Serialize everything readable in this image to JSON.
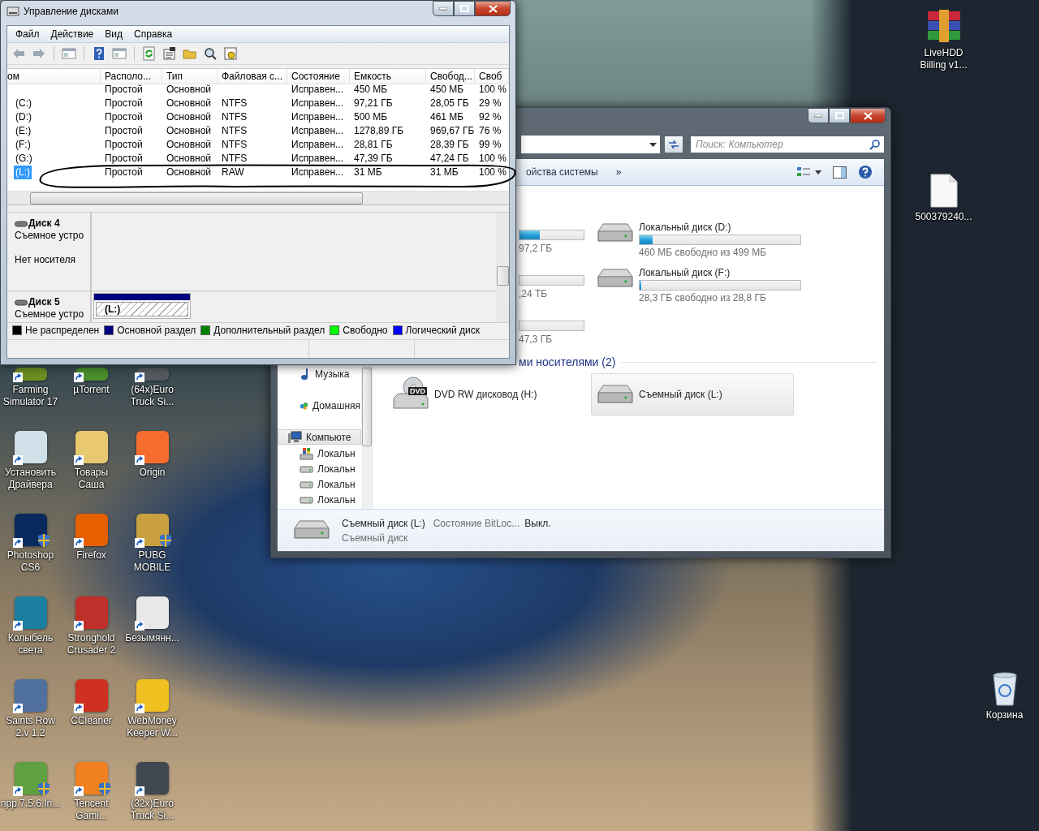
{
  "disk_management": {
    "title": "Управление дисками",
    "menu": [
      "Файл",
      "Действие",
      "Вид",
      "Справка"
    ],
    "columns": [
      "ом",
      "Располо...",
      "Тип",
      "Файловая с...",
      "Состояние",
      "Емкость",
      "Свобод...",
      "Своб"
    ],
    "rows": [
      {
        "layout": "Простой",
        "type": "Основной",
        "status": "Исправен...",
        "capacity": "450 МБ",
        "free": "450 МБ",
        "free_pct": "100 %",
        "selected": false
      },
      {
        "volume": "(C:)",
        "layout": "Простой",
        "type": "Основной",
        "fs": "NTFS",
        "status": "Исправен...",
        "capacity": "97,21 ГБ",
        "free": "28,05 ГБ",
        "free_pct": "29 %",
        "selected": false
      },
      {
        "volume": "(D:)",
        "layout": "Простой",
        "type": "Основной",
        "fs": "NTFS",
        "status": "Исправен...",
        "capacity": "500 МБ",
        "free": "461 МБ",
        "free_pct": "92 %",
        "selected": false
      },
      {
        "volume": "(E:)",
        "layout": "Простой",
        "type": "Основной",
        "fs": "NTFS",
        "status": "Исправен...",
        "capacity": "1278,89 ГБ",
        "free": "969,67 ГБ",
        "free_pct": "76 %",
        "selected": false
      },
      {
        "volume": "(F:)",
        "layout": "Простой",
        "type": "Основной",
        "fs": "NTFS",
        "status": "Исправен...",
        "capacity": "28,81 ГБ",
        "free": "28,39 ГБ",
        "free_pct": "99 %",
        "selected": false
      },
      {
        "volume": "(G:)",
        "layout": "Простой",
        "type": "Основной",
        "fs": "NTFS",
        "status": "Исправен...",
        "capacity": "47,39 ГБ",
        "free": "47,24 ГБ",
        "free_pct": "100 %",
        "selected": false
      },
      {
        "volume": "(L:)",
        "layout": "Простой",
        "type": "Основной",
        "fs": "RAW",
        "status": "Исправен...",
        "capacity": "31 МБ",
        "free": "31 МБ",
        "free_pct": "100 %",
        "selected": true
      }
    ],
    "disks": [
      {
        "name": "Диск 4",
        "type": "Съемное устро",
        "status": "Нет носителя"
      },
      {
        "name": "Диск 5",
        "type": "Съемное устро",
        "partition": "(L:)"
      }
    ],
    "legend": [
      {
        "label": "Не распределен",
        "color": "#000000"
      },
      {
        "label": "Основной раздел",
        "color": "#000080"
      },
      {
        "label": "Дополнительный раздел",
        "color": "#008000"
      },
      {
        "label": "Свободно",
        "color": "#00ff00"
      },
      {
        "label": "Логический диск",
        "color": "#0000ff"
      }
    ]
  },
  "explorer": {
    "search": {
      "placeholder": "Поиск: Компьютер"
    },
    "toolbar_item": "ойства системы",
    "more": "»",
    "nav": [
      {
        "label": "Музыка",
        "kind": "music",
        "selected": false
      },
      {
        "label": "Домашняя",
        "kind": "homegroup",
        "selected": false
      },
      {
        "label": "Компьюте",
        "kind": "computer",
        "selected": true
      },
      {
        "label": "Локальн",
        "kind": "system-drive",
        "selected": false
      },
      {
        "label": "Локальн",
        "kind": "drive",
        "selected": false
      },
      {
        "label": "Локальн",
        "kind": "drive",
        "selected": false
      },
      {
        "label": "Локальн",
        "kind": "drive",
        "selected": false
      }
    ],
    "drives": [
      {
        "info": "97,2 ГБ",
        "level": 0.32
      },
      {
        "name": "Локальный диск (D:)",
        "info": "460 МБ свободно из 499 МБ",
        "level": 0.08
      },
      {
        "info": ",24 ТБ"
      },
      {
        "name": "Локальный диск (F:)",
        "info": "28,3 ГБ свободно из 28,8 ГБ",
        "level": 0.01
      },
      {
        "info": "47,3 ГБ"
      }
    ],
    "section_title": "ми носителями (2)",
    "removable": [
      {
        "name": "DVD RW дисковод (H:)",
        "kind": "dvd",
        "icon_label": "DVD",
        "selected": false
      },
      {
        "name": "Съемный диск (L:)",
        "kind": "removable",
        "selected": true
      }
    ],
    "details": {
      "name": "Съемный диск (L:)",
      "property": "Состояние BitLoc...",
      "value": "Выкл.",
      "type": "Съемный диск"
    }
  },
  "desktop_icons": [
    {
      "lines": [
        "Farming",
        "Simulator 17"
      ],
      "color": "#6b8e23",
      "shield": false
    },
    {
      "lines": [
        "µTorrent"
      ],
      "color": "#4a8f2c",
      "shield": false
    },
    {
      "lines": [
        "(64x)Euro",
        "Truck Si..."
      ],
      "color": "#555a60",
      "shield": false
    },
    {
      "lines": [
        "Установить",
        "Драйвера"
      ],
      "color": "#cfe0e8",
      "shield": false
    },
    {
      "lines": [
        "Товары",
        "Саша"
      ],
      "color": "#e8c870",
      "shield": false
    },
    {
      "lines": [
        "Origin"
      ],
      "color": "#f56c2d",
      "shield": false
    },
    {
      "lines": [
        "Photoshop",
        "CS6"
      ],
      "color": "#0a2a5e",
      "shield": true
    },
    {
      "lines": [
        "Firefox"
      ],
      "color": "#e66000",
      "shield": false
    },
    {
      "lines": [
        "PUBG",
        "MOBILE"
      ],
      "color": "#c9a040",
      "shield": true
    },
    {
      "lines": [
        "Колыбель",
        "света"
      ],
      "color": "#1a7fa0",
      "shield": false
    },
    {
      "lines": [
        "Stronghold",
        "Crusader 2"
      ],
      "color": "#c0302a",
      "shield": false
    },
    {
      "lines": [
        "Безымянн..."
      ],
      "color": "#e8e8e8",
      "shield": false
    },
    {
      "lines": [
        "Saints Row",
        "2.v 1.2"
      ],
      "color": "#5070a0",
      "shield": false
    },
    {
      "lines": [
        "CCleaner"
      ],
      "color": "#d03020",
      "shield": false
    },
    {
      "lines": [
        "WebMoney",
        "Keeper W..."
      ],
      "color": "#f0c020",
      "shield": false
    },
    {
      "lines": [
        "npp.7.5.6.In..."
      ],
      "color": "#60a040",
      "shield": true
    },
    {
      "lines": [
        "Tencent",
        "Gami..."
      ],
      "color": "#f08020",
      "shield": true
    },
    {
      "lines": [
        "(32x)Euro",
        "Truck Si..."
      ],
      "color": "#404850",
      "shield": false
    }
  ],
  "right_icons": [
    {
      "lines": [
        "LiveHDD",
        "Billing v1..."
      ],
      "kind": "archive"
    },
    {
      "lines": [
        "500379240..."
      ],
      "kind": "file"
    },
    {
      "lines": [
        "Корзина"
      ],
      "kind": "bin"
    }
  ]
}
